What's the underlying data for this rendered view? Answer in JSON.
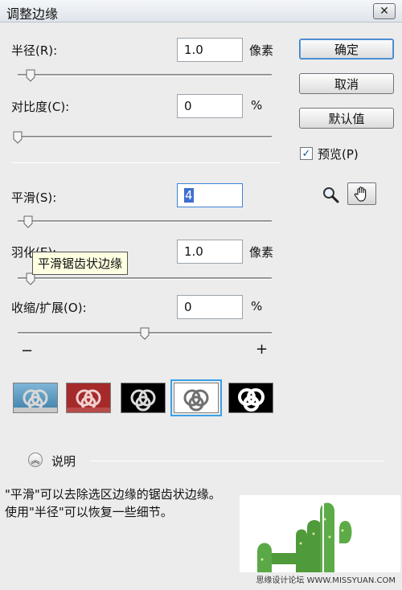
{
  "window": {
    "title": "调整边缘",
    "close_label": "✕"
  },
  "fields": {
    "radius": {
      "label": "半径(R):",
      "value": "1.0",
      "unit": "像素",
      "slider_level": 0.05
    },
    "contrast": {
      "label": "对比度(C):",
      "value": "0",
      "unit": "%",
      "slider_level": 0.0
    },
    "smooth": {
      "label": "平滑(S):",
      "value": "4",
      "unit": "",
      "slider_level": 0.04
    },
    "feather": {
      "label": "羽化(E):",
      "value": "1.0",
      "unit": "像素",
      "slider_level": 0.05
    },
    "contract_expand": {
      "label": "收缩/扩展(O):",
      "value": "0",
      "unit": "%",
      "slider_level": 0.5,
      "minus_label": "−",
      "plus_label": "+"
    }
  },
  "tooltip": {
    "text": "平滑锯齿状边缘"
  },
  "buttons": {
    "ok": "确定",
    "cancel": "取消",
    "default": "默认值"
  },
  "preview_checkbox": {
    "label": "预览(P)",
    "checked": true,
    "check_mark": "✓"
  },
  "tools": {
    "zoom": "zoom-icon",
    "hand": "hand-icon"
  },
  "view_modes": [
    {
      "name": "standard",
      "selected": false
    },
    {
      "name": "quick-mask",
      "selected": false
    },
    {
      "name": "on-black",
      "selected": false
    },
    {
      "name": "on-white",
      "selected": true
    },
    {
      "name": "mask",
      "selected": false
    }
  ],
  "description": {
    "toggle_label": "说明",
    "text": "\"平滑\"可以去除选区边缘的锯齿状边缘。使用\"半径\"可以恢复一些细节。"
  },
  "watermark": "思缘设计论坛 WWW.MISSYUAN.COM",
  "colors": {
    "accent": "#3d6fd1",
    "selection_outline": "#3ba0e6",
    "tooltip_bg": "#ffffe1"
  }
}
